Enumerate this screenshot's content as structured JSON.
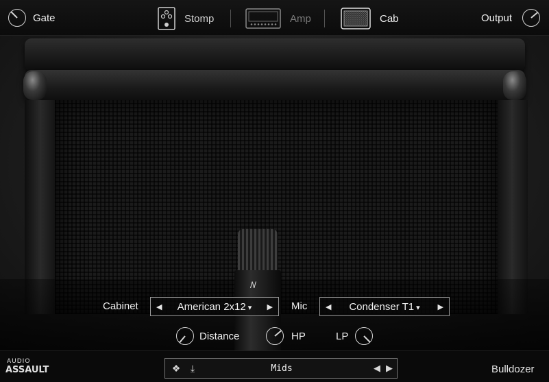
{
  "header": {
    "gate_label": "Gate",
    "output_label": "Output",
    "tabs": [
      {
        "label": "Stomp",
        "icon": "stompbox-icon",
        "state": "inactive"
      },
      {
        "label": "Amp",
        "icon": "amp-head-icon",
        "state": "disabled"
      },
      {
        "label": "Cab",
        "icon": "cabinet-icon",
        "state": "active"
      }
    ]
  },
  "controls": {
    "cabinet_label": "Cabinet",
    "cabinet_value": "American 2x12",
    "mic_label": "Mic",
    "mic_value": "Condenser T1",
    "distance_label": "Distance",
    "hp_label": "HP",
    "lp_label": "LP"
  },
  "footer": {
    "brand_top": "AUDIO",
    "brand_bottom": "ASSAULT",
    "preset_name": "Mids",
    "product_name": "Bulldozer"
  },
  "colors": {
    "text": "#f0f0f0",
    "inactive_tab": "#7a7a7a",
    "background": "#0c0c0c",
    "border": "#9a9a9a"
  }
}
